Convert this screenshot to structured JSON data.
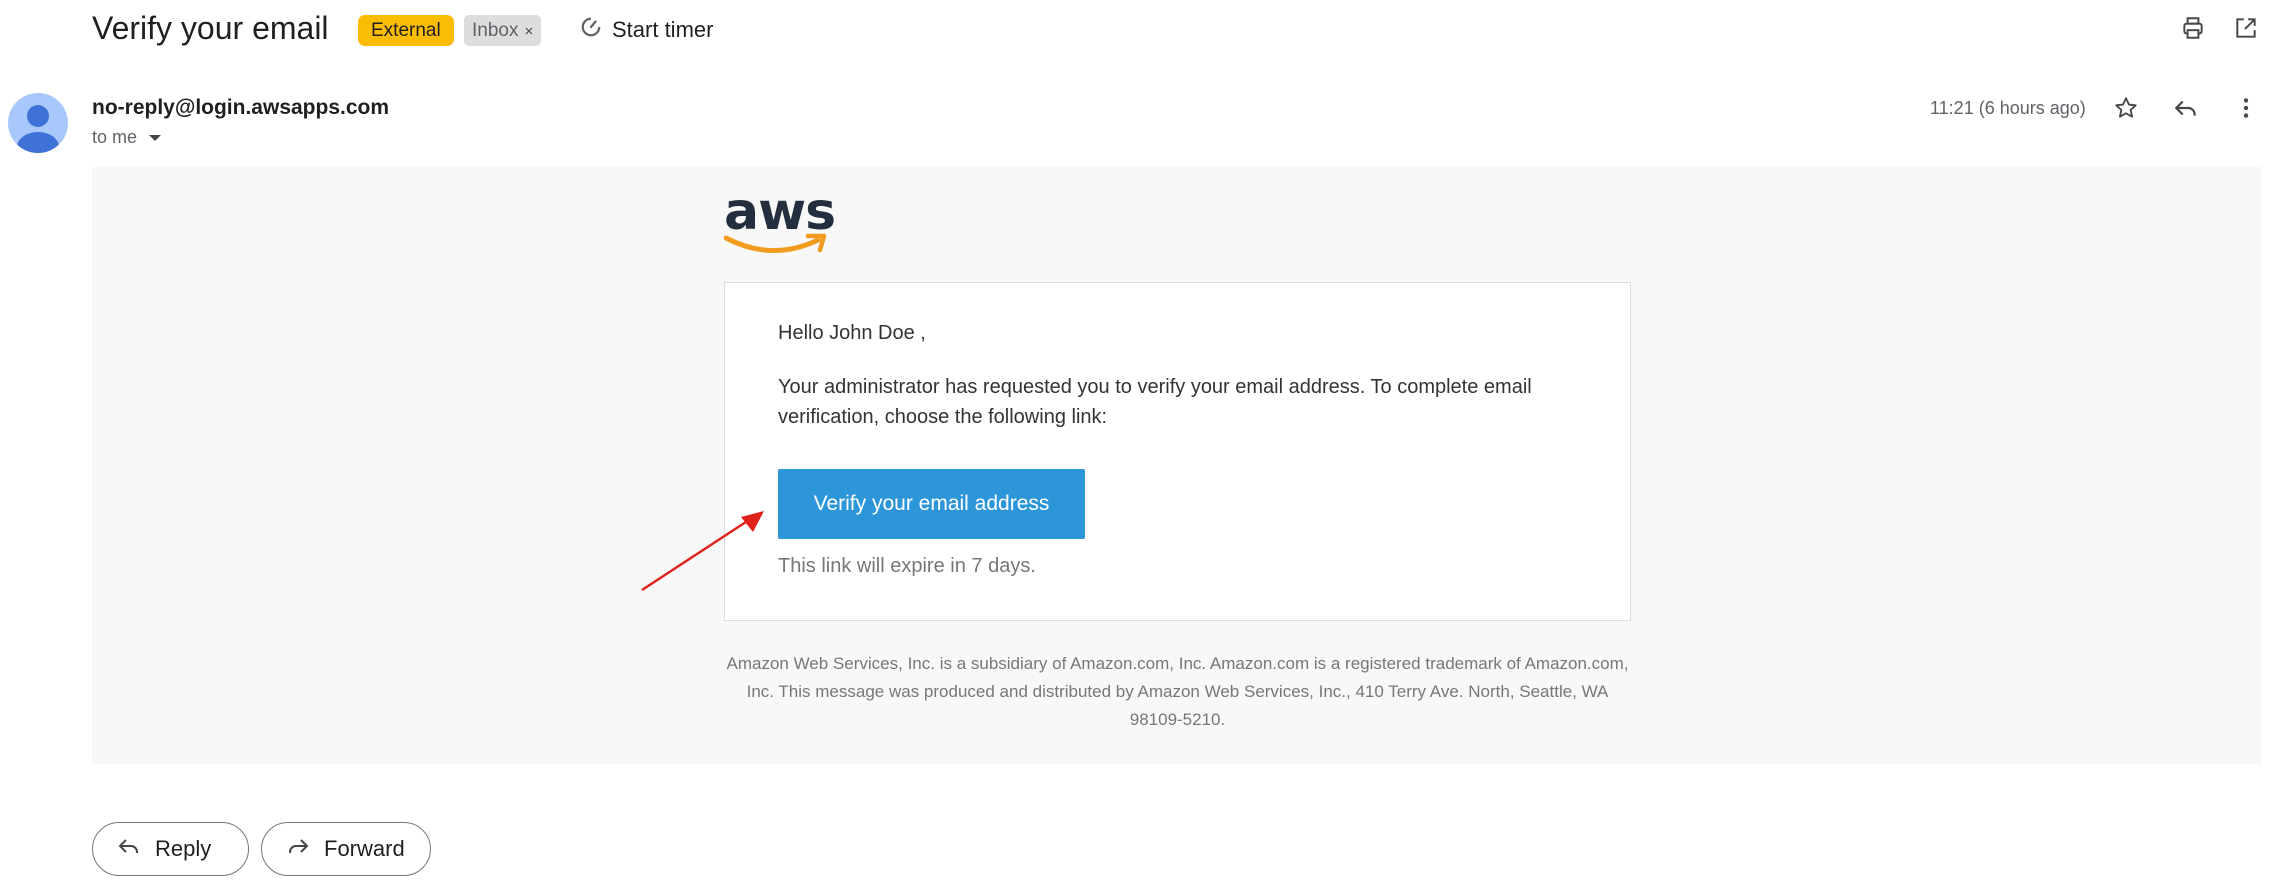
{
  "header": {
    "subject": "Verify your email",
    "labels": [
      {
        "text": "External",
        "color": "#fbbc04"
      },
      {
        "text": "Inbox",
        "remove": "×"
      }
    ],
    "timer_label": "Start timer",
    "icons": [
      "print-icon",
      "open-in-new-window-icon"
    ]
  },
  "message": {
    "sender": "no-reply@login.awsapps.com",
    "recipient": "to me",
    "timestamp": "11:21 (6 hours ago)",
    "icons": [
      "star-icon",
      "reply-icon",
      "more-vert-icon"
    ]
  },
  "email_body": {
    "logo_text": "aws",
    "greeting": "Hello John Doe ,",
    "paragraph": "Your administrator has requested you to verify your email address. To complete email verification, choose the following link:",
    "button_label": "Verify your email address",
    "expiry_note": "This link will expire in 7 days.",
    "footer": "Amazon Web Services, Inc. is a subsidiary of Amazon.com, Inc. Amazon.com is a registered trademark of Amazon.com, Inc. This message was produced and distributed by Amazon Web Services, Inc., 410 Terry Ave. North, Seattle, WA 98109-5210.",
    "button_color": "#2d96d9",
    "annotation": "red-arrow-pointing-to-button"
  },
  "actions": {
    "reply_label": "Reply",
    "forward_label": "Forward"
  }
}
